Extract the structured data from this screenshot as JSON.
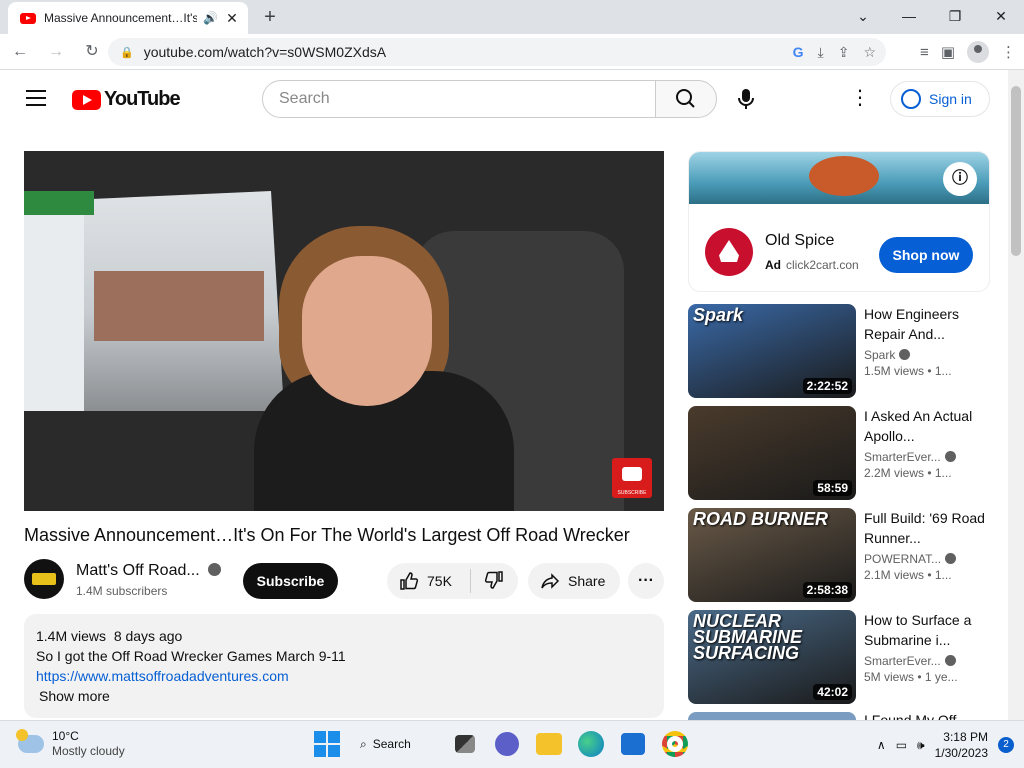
{
  "browser": {
    "tab_title": "Massive Announcement…It's",
    "url": "youtube.com/watch?v=s0WSM0ZXdsA"
  },
  "youtube": {
    "logo_text": "YouTube",
    "search_placeholder": "Search",
    "signin_label": "Sign in"
  },
  "video": {
    "title": "Massive Announcement…It's On For The World's Largest Off Road Wrecker",
    "channel_name": "Matt's Off Road...",
    "subscribers": "1.4M subscribers",
    "subscribe_label": "Subscribe",
    "likes": "75K",
    "share_label": "Share",
    "watermark_text": "SUBSCRIBE"
  },
  "description": {
    "views": "1.4M views",
    "age": "8 days ago",
    "line1": "So I got the Off Road Wrecker Games March 9-11",
    "link": "https://www.mattsoffroadadventures.com",
    "show_more": "Show more"
  },
  "ad": {
    "name": "Old Spice",
    "badge": "Ad",
    "domain": "click2cart.con",
    "cta": "Shop now"
  },
  "recommendations": [
    {
      "title": "How Engineers Repair And...",
      "channel": "Spark",
      "meta": "1.5M views • 1...",
      "duration": "2:22:52",
      "thumb_text": "Spark",
      "thumb_color": "#3a6aa8"
    },
    {
      "title": "I Asked An Actual Apollo...",
      "channel": "SmarterEver...",
      "meta": "2.2M views • 1...",
      "duration": "58:59",
      "thumb_text": "",
      "thumb_color": "#4a3b2c"
    },
    {
      "title": "Full Build: '69 Road Runner...",
      "channel": "POWERNAT...",
      "meta": "2.1M views • 1...",
      "duration": "2:58:38",
      "thumb_text": "ROAD BURNER",
      "thumb_color": "#6a5a48"
    },
    {
      "title": "How to Surface a Submarine i...",
      "channel": "SmarterEver...",
      "meta": "5M views • 1 ye...",
      "duration": "42:02",
      "thumb_text": "NUCLEAR SUBMARINE SURFACING",
      "thumb_color": "#4a6a88"
    }
  ],
  "partial_next_title": "I Found My Off...",
  "taskbar": {
    "temp": "10°C",
    "weather": "Mostly cloudy",
    "search_label": "Search",
    "time": "3:18 PM",
    "date": "1/30/2023",
    "notifications": "2"
  }
}
